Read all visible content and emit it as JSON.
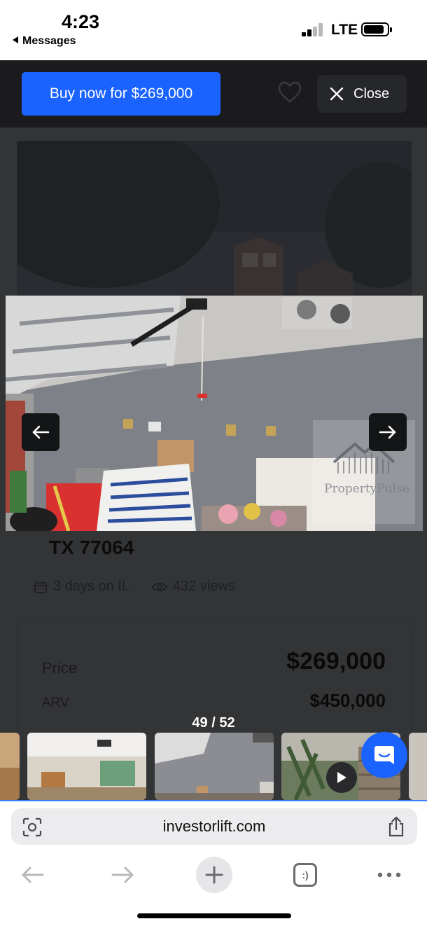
{
  "status_bar": {
    "time": "4:23",
    "back_label": "Messages",
    "network": "LTE"
  },
  "header": {
    "buy_button_label": "Buy now for $269,000",
    "close_label": "Close"
  },
  "listing": {
    "address_line": "TX 77064",
    "days_on": "3 days on IL",
    "views": "432 views",
    "price_label": "Price",
    "price_value": "$269,000",
    "arv_label": "ARV",
    "arv_value": "$450,000"
  },
  "gallery": {
    "watermark_text": "PropertyPulse",
    "counter": "49 / 52",
    "thumbnails": [
      "garage-interior",
      "garage-wall",
      "backyard-video"
    ]
  },
  "browser": {
    "url": "investorlift.com",
    "tabs_badge": ":)"
  },
  "colors": {
    "accent_blue": "#1a63ff",
    "overlay_dark": "#333436"
  }
}
